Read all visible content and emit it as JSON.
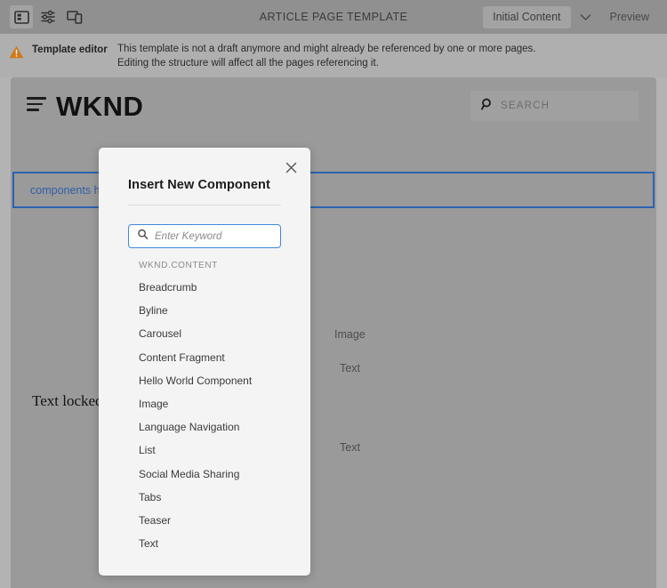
{
  "toolbar": {
    "icons": [
      {
        "name": "side-panel-icon",
        "label": "Toggle Side Panel",
        "active": true
      },
      {
        "name": "page-properties-icon",
        "label": "Page Properties",
        "active": false
      },
      {
        "name": "responsive-layout-icon",
        "label": "Layout / Emulator",
        "active": false
      }
    ],
    "title": "ARTICLE PAGE TEMPLATE",
    "mode_selector": "Initial Content",
    "chevron": "chevron-down-icon",
    "preview_label": "Preview"
  },
  "alert": {
    "icon": "warning-icon",
    "title": "Template editor",
    "message": "This template is not a draft anymore and might already be referenced by one or more pages. Editing the structure will affect all the pages referencing it."
  },
  "page": {
    "menu_icon": "hamburger-menu-icon",
    "logo": "WKND",
    "search": {
      "icon": "search-icon",
      "label": "SEARCH"
    },
    "dropzone_text": "components here",
    "placeholders": {
      "image": "Image",
      "text_one": "Text",
      "text_two": "Text",
      "locked_text": "Text locked"
    }
  },
  "dialog": {
    "close_icon": "close-icon",
    "title": "Insert New Component",
    "search": {
      "icon": "search-icon",
      "placeholder": "Enter Keyword",
      "value": ""
    },
    "group_label": "WKND.CONTENT",
    "components": [
      "Breadcrumb",
      "Byline",
      "Carousel",
      "Content Fragment",
      "Hello World Component",
      "Image",
      "Language Navigation",
      "List",
      "Social Media Sharing",
      "Tabs",
      "Teaser",
      "Text"
    ]
  },
  "colors": {
    "accent_blue": "#2a63b0",
    "focus_blue": "#3d8ae0",
    "warning_orange": "#d07818",
    "toolbar_gray": "#909090",
    "alert_gray": "#afafaf",
    "canvas_gray": "#9a9a9a",
    "dialog_bg": "#f4f4f4"
  }
}
